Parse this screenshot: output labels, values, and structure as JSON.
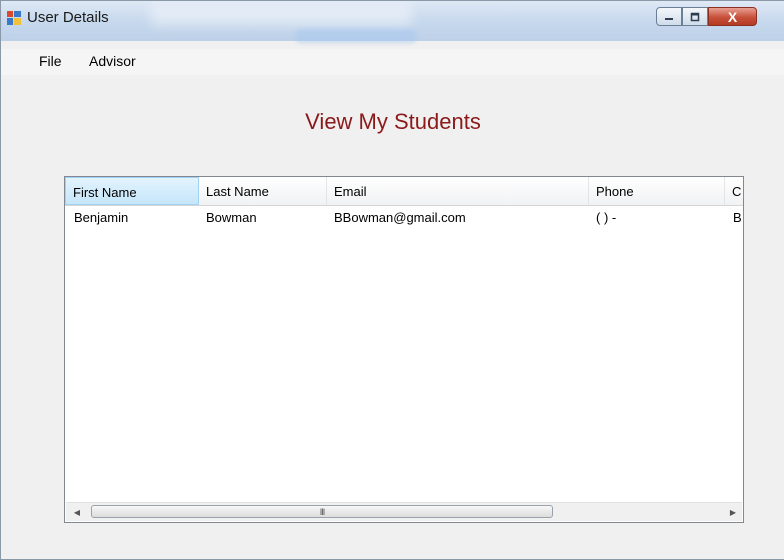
{
  "window": {
    "title": "User Details",
    "close_label": "X"
  },
  "menu": {
    "items": [
      {
        "label": "File"
      },
      {
        "label": "Advisor"
      }
    ]
  },
  "main": {
    "heading": "View My Students"
  },
  "table": {
    "columns": [
      "First Name",
      "Last Name",
      "Email",
      "Phone",
      "C"
    ],
    "rows": [
      [
        "Benjamin",
        "Bowman",
        "BBowman@gmail.com",
        "(  )  -",
        "B"
      ]
    ]
  },
  "scrollbar": {
    "left_arrow": "◀",
    "right_arrow": "▶",
    "grip": "III"
  },
  "colors": {
    "heading": "#8b1a1a",
    "close_button": "#c7503a"
  },
  "icons": [
    "app-window-icon",
    "minimize-icon",
    "maximize-icon",
    "close-icon",
    "scroll-left-icon",
    "scroll-right-icon"
  ]
}
